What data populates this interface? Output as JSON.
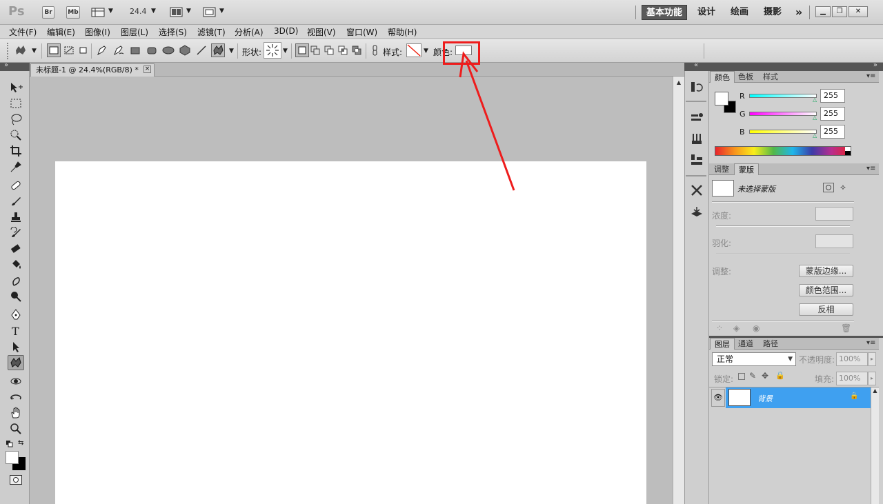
{
  "app": {
    "logo": "Ps",
    "bridge_btn": "Br",
    "minibridge_btn": "Mb",
    "zoom": "24.4",
    "workspaces": [
      "基本功能",
      "设计",
      "绘画",
      "摄影"
    ],
    "more_workspaces": "»",
    "window_controls": [
      "minimize-icon",
      "restore-icon",
      "close-icon"
    ]
  },
  "menu": [
    "文件(F)",
    "编辑(E)",
    "图像(I)",
    "图层(L)",
    "选择(S)",
    "滤镜(T)",
    "分析(A)",
    "3D(D)",
    "视图(V)",
    "窗口(W)",
    "帮助(H)"
  ],
  "options": {
    "shape_label": "形状:",
    "style_label": "样式:",
    "color_label": "颜色:",
    "color_value": "#ffffff"
  },
  "document": {
    "tab_title": "未标题-1 @ 24.4%(RGB/8) *",
    "canvas_color": "#ffffff"
  },
  "color_panel": {
    "tabs": [
      "颜色",
      "色板",
      "样式"
    ],
    "r": "255",
    "g": "255",
    "b": "255",
    "r_label": "R",
    "g_label": "G",
    "b_label": "B"
  },
  "masks_panel": {
    "tabs": [
      "调整",
      "蒙版"
    ],
    "status": "未选择蒙版",
    "density_label": "浓度:",
    "feather_label": "羽化:",
    "refine_label": "调整:",
    "mask_edge_btn": "蒙版边缘...",
    "color_range_btn": "颜色范围...",
    "invert_btn": "反相"
  },
  "layers_panel": {
    "tabs": [
      "图层",
      "通道",
      "路径"
    ],
    "blend_mode": "正常",
    "opacity_label": "不透明度:",
    "opacity_value": "100%",
    "lock_label": "锁定:",
    "fill_label": "填充:",
    "fill_value": "100%",
    "layers": [
      {
        "name": "背景",
        "selected": true,
        "locked": true
      }
    ]
  },
  "annotation": {
    "highlight_color": "#ee1c1c",
    "target": "颜色 swatch"
  }
}
